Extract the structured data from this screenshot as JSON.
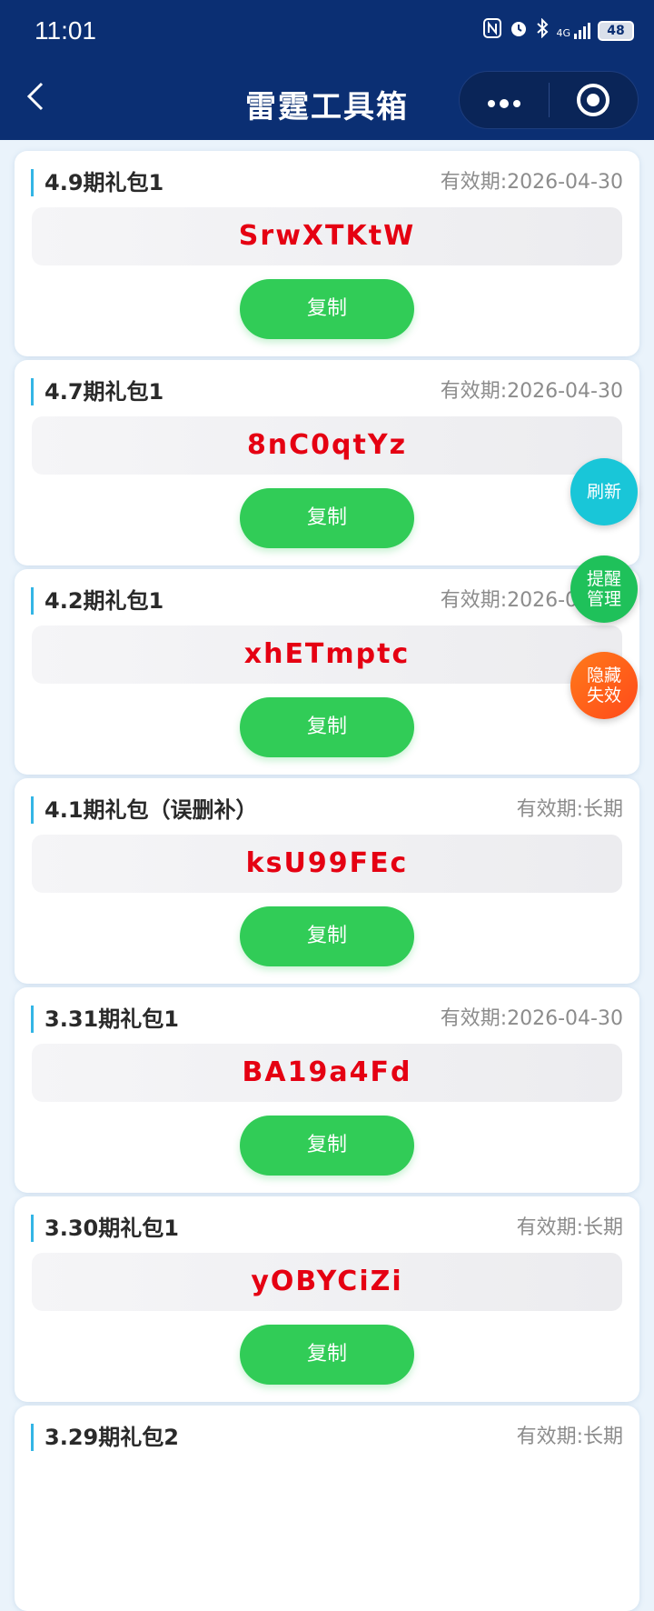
{
  "status_bar": {
    "time": "11:01",
    "network": "4G",
    "battery": "48",
    "icons": [
      "nfc-icon",
      "alarm-icon",
      "bluetooth-icon",
      "signal-icon",
      "battery-icon"
    ]
  },
  "navbar": {
    "title": "雷霆工具箱",
    "back_icon": "chevron-left-icon",
    "more_icon": "more-dots-icon",
    "target_icon": "target-circle-icon"
  },
  "copy_label": "复制",
  "cards": [
    {
      "title": "4.9期礼包1",
      "expiry": "有效期:2026-04-30",
      "code": "SrwXTKtW"
    },
    {
      "title": "4.7期礼包1",
      "expiry": "有效期:2026-04-30",
      "code": "8nC0qtYz"
    },
    {
      "title": "4.2期礼包1",
      "expiry": "有效期:2026-04-30",
      "code": "xhETmptc"
    },
    {
      "title": "4.1期礼包（误删补）",
      "expiry": "有效期:长期",
      "code": "ksU99FEc"
    },
    {
      "title": "3.31期礼包1",
      "expiry": "有效期:2026-04-30",
      "code": "BA19a4Fd"
    },
    {
      "title": "3.30期礼包1",
      "expiry": "有效期:长期",
      "code": "yOBYCiZi"
    },
    {
      "title": "3.29期礼包2",
      "expiry": "有效期:长期",
      "code": ""
    }
  ],
  "fabs": {
    "refresh": "刷新",
    "remind_1": "提醒",
    "remind_2": "管理",
    "hide_1": "隐藏",
    "hide_2": "失效"
  },
  "colors": {
    "header": "#0b2f73",
    "code": "#e50012",
    "copy_button": "#31cc57",
    "refresh": "#19c6d8",
    "remind": "#1fc15a",
    "hide": "#ff5a1a"
  }
}
